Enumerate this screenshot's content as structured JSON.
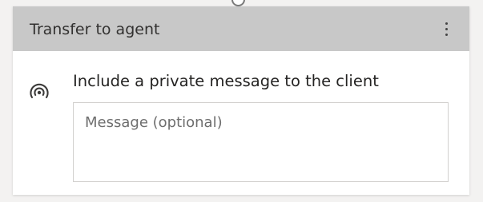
{
  "node": {
    "title": "Transfer to agent",
    "menu_icon": "more-vertical-icon"
  },
  "private_message": {
    "icon": "broadcast-icon",
    "label": "Include a private message to the client",
    "placeholder": "Message (optional)",
    "value": ""
  }
}
